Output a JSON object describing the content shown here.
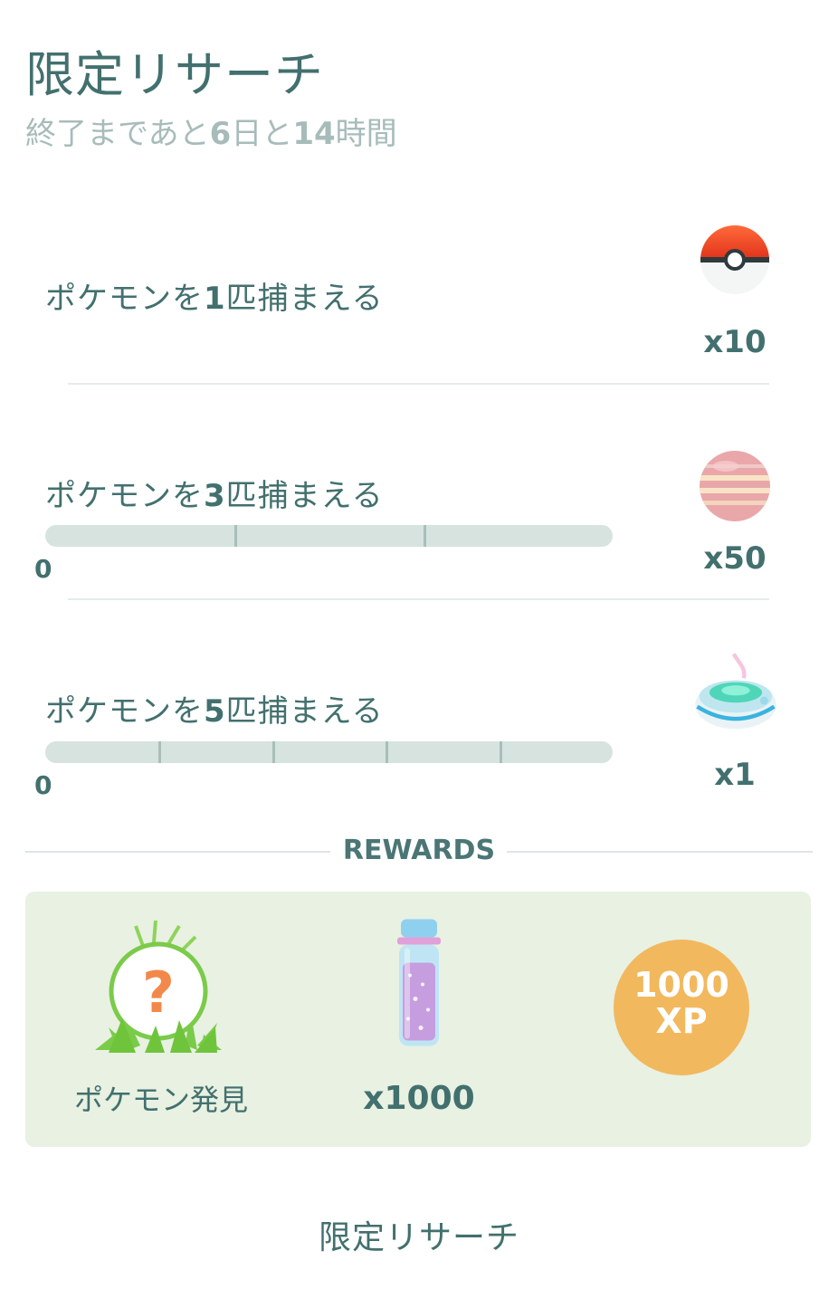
{
  "header": {
    "title": "限定リサーチ",
    "time_prefix": "終了まであと",
    "days": "6",
    "days_unit": "日と",
    "hours": "14",
    "hours_unit": "時間"
  },
  "tasks": [
    {
      "label_prefix": "ポケモンを",
      "count": "1",
      "label_suffix": "匹捕まえる",
      "reward_icon": "poke-ball-icon",
      "reward_qty": "x10",
      "progress": null
    },
    {
      "label_prefix": "ポケモンを",
      "count": "3",
      "label_suffix": "匹捕まえる",
      "reward_icon": "nanab-berry-icon",
      "reward_qty": "x50",
      "progress": 0,
      "progress_start": "0"
    },
    {
      "label_prefix": "ポケモンを",
      "count": "5",
      "label_suffix": "匹捕まえる",
      "reward_icon": "incense-icon",
      "reward_qty": "x1",
      "progress": 0,
      "progress_start": "0"
    }
  ],
  "rewards": {
    "header": "REWARDS",
    "encounter_caption": "ポケモン発見",
    "stardust_qty": "x1000",
    "xp_amount": "1000",
    "xp_unit": "XP"
  },
  "footer": {
    "label": "限定リサーチ"
  },
  "colors": {
    "accent": "#42706e",
    "muted": "#a7bcba",
    "progress_track": "#d6e3df",
    "rewards_bg": "#e8f1e2",
    "xp_gold": "#f2b85e"
  }
}
